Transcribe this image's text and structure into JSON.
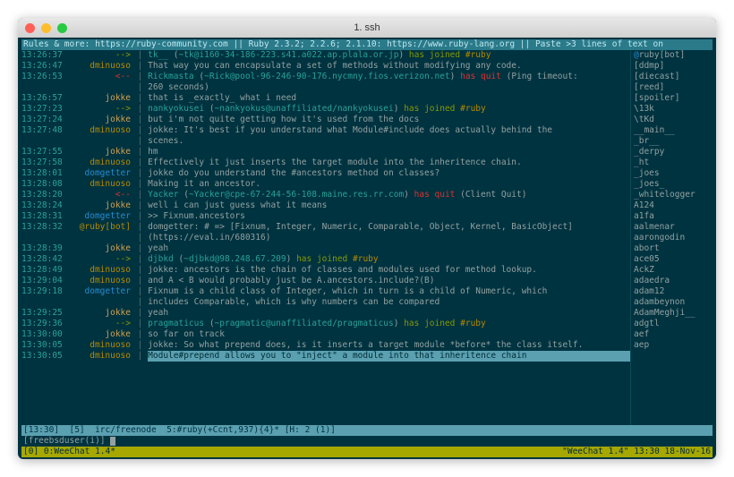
{
  "window": {
    "title": "1. ssh"
  },
  "topbar": "Rules & more: https://ruby-community.com || Ruby 2.3.2; 2.2.6; 2.1.10: https://www.ruby-lang.org || Paste >3 lines of text on",
  "nicklist": [
    {
      "p": "@",
      "n": "ruby[bot]"
    },
    {
      "p": " ",
      "n": "[ddmp]"
    },
    {
      "p": " ",
      "n": "[diecast]"
    },
    {
      "p": " ",
      "n": "[reed]"
    },
    {
      "p": " ",
      "n": "[spoiler]"
    },
    {
      "p": " ",
      "n": "\\13k"
    },
    {
      "p": " ",
      "n": "\\tKd"
    },
    {
      "p": " ",
      "n": "__main__"
    },
    {
      "p": " ",
      "n": "_br__"
    },
    {
      "p": " ",
      "n": "_derpy"
    },
    {
      "p": " ",
      "n": "_ht"
    },
    {
      "p": " ",
      "n": "_joes"
    },
    {
      "p": " ",
      "n": "_joes_"
    },
    {
      "p": " ",
      "n": "_whitelogger"
    },
    {
      "p": " ",
      "n": "A124"
    },
    {
      "p": " ",
      "n": "a1fa"
    },
    {
      "p": " ",
      "n": "aalmenar"
    },
    {
      "p": " ",
      "n": "aarongodin"
    },
    {
      "p": " ",
      "n": "abort"
    },
    {
      "p": " ",
      "n": "ace05"
    },
    {
      "p": " ",
      "n": "AckZ"
    },
    {
      "p": " ",
      "n": "adaedra"
    },
    {
      "p": " ",
      "n": "adam12"
    },
    {
      "p": " ",
      "n": "adambeynon"
    },
    {
      "p": " ",
      "n": "AdamMeghji__"
    },
    {
      "p": " ",
      "n": "adgtl"
    },
    {
      "p": " ",
      "n": "aef"
    },
    {
      "p": " ",
      "n": "aep"
    }
  ],
  "log": [
    {
      "ts": "13:26:37",
      "nick": "-->",
      "ncolor": "arrow-in",
      "msg": [
        {
          "c": "username",
          "t": "tk__"
        },
        {
          "t": " ("
        },
        {
          "c": "host",
          "t": "~tk@i160-34-186-223.s41.a022.ap.plala.or.jp"
        },
        {
          "t": ") "
        },
        {
          "c": "joined",
          "t": "has joined"
        },
        {
          "t": " "
        },
        {
          "c": "channel",
          "t": "#ruby"
        }
      ]
    },
    {
      "ts": "13:26:47",
      "nick": "dminuoso",
      "ncolor": "dminuoso",
      "msg": [
        {
          "t": "That way you can encapsulate a set of methods without modifying any code."
        }
      ]
    },
    {
      "ts": "13:26:53",
      "nick": "<--",
      "ncolor": "arrow-out",
      "msg": [
        {
          "c": "username",
          "t": "Rickmasta"
        },
        {
          "t": " ("
        },
        {
          "c": "host",
          "t": "~Rick@pool-96-246-90-176.nycmny.fios.verizon.net"
        },
        {
          "t": ") "
        },
        {
          "c": "quit",
          "t": "has quit"
        },
        {
          "t": " (Ping timeout:"
        }
      ]
    },
    {
      "ts": "",
      "nick": "",
      "msg": [
        {
          "t": "260 seconds)"
        }
      ]
    },
    {
      "ts": "13:26:57",
      "nick": "jokke",
      "ncolor": "jokke",
      "msg": [
        {
          "t": "that is _exactly_ what i need"
        }
      ]
    },
    {
      "ts": "13:27:23",
      "nick": "-->",
      "ncolor": "arrow-in",
      "msg": [
        {
          "c": "username",
          "t": "nankyokusei"
        },
        {
          "t": " ("
        },
        {
          "c": "host",
          "t": "~nankyokus@unaffiliated/nankyokusei"
        },
        {
          "t": ") "
        },
        {
          "c": "joined",
          "t": "has joined"
        },
        {
          "t": " "
        },
        {
          "c": "channel",
          "t": "#ruby"
        }
      ]
    },
    {
      "ts": "13:27:24",
      "nick": "jokke",
      "ncolor": "jokke",
      "msg": [
        {
          "t": "but i'm not quite getting how it's used from the docs"
        }
      ]
    },
    {
      "ts": "13:27:48",
      "nick": "dminuoso",
      "ncolor": "dminuoso",
      "msg": [
        {
          "t": "jokke: It's best if you understand what Module#include does actually behind the"
        }
      ]
    },
    {
      "ts": "",
      "nick": "",
      "msg": [
        {
          "t": "scenes."
        }
      ]
    },
    {
      "ts": "13:27:55",
      "nick": "jokke",
      "ncolor": "jokke",
      "msg": [
        {
          "t": "hm"
        }
      ]
    },
    {
      "ts": "13:27:58",
      "nick": "dminuoso",
      "ncolor": "dminuoso",
      "msg": [
        {
          "t": "Effectively it just inserts the target module into the inheritence chain."
        }
      ]
    },
    {
      "ts": "13:28:01",
      "nick": "domgetter",
      "ncolor": "domgetter",
      "msg": [
        {
          "t": "jokke do you understand the #ancestors method on classes?"
        }
      ]
    },
    {
      "ts": "13:28:08",
      "nick": "dminuoso",
      "ncolor": "dminuoso",
      "msg": [
        {
          "t": "Making it an ancestor."
        }
      ]
    },
    {
      "ts": "13:28:20",
      "nick": "<--",
      "ncolor": "arrow-out",
      "msg": [
        {
          "c": "username",
          "t": "Yacker"
        },
        {
          "t": " ("
        },
        {
          "c": "host",
          "t": "~Yacker@cpe-67-244-56-108.maine.res.rr.com"
        },
        {
          "t": ") "
        },
        {
          "c": "quit",
          "t": "has quit"
        },
        {
          "t": " (Client Quit)"
        }
      ]
    },
    {
      "ts": "13:28:24",
      "nick": "jokke",
      "ncolor": "jokke",
      "msg": [
        {
          "t": "well i can just guess what it means"
        }
      ]
    },
    {
      "ts": "13:28:31",
      "nick": "domgetter",
      "ncolor": "domgetter",
      "msg": [
        {
          "t": ">> Fixnum.ancestors"
        }
      ]
    },
    {
      "ts": "13:28:32",
      "nick": "@ruby[bot]",
      "ncolor": "ruby-bot",
      "msg": [
        {
          "t": "domgetter: # => [Fixnum, Integer, Numeric, Comparable, Object, Kernel, BasicObject]"
        }
      ]
    },
    {
      "ts": "",
      "nick": "",
      "msg": [
        {
          "t": "(https://eval.in/680316)"
        }
      ]
    },
    {
      "ts": "13:28:39",
      "nick": "jokke",
      "ncolor": "jokke",
      "msg": [
        {
          "t": "yeah"
        }
      ]
    },
    {
      "ts": "13:28:42",
      "nick": "-->",
      "ncolor": "arrow-in",
      "msg": [
        {
          "c": "username",
          "t": "djbkd"
        },
        {
          "t": " ("
        },
        {
          "c": "host",
          "t": "~djbkd@98.248.67.209"
        },
        {
          "t": ") "
        },
        {
          "c": "joined",
          "t": "has joined"
        },
        {
          "t": " "
        },
        {
          "c": "channel",
          "t": "#ruby"
        }
      ]
    },
    {
      "ts": "13:28:49",
      "nick": "dminuoso",
      "ncolor": "dminuoso",
      "msg": [
        {
          "t": "jokke: ancestors is the chain of classes and modules used for method lookup."
        }
      ]
    },
    {
      "ts": "13:29:04",
      "nick": "dminuoso",
      "ncolor": "dminuoso",
      "msg": [
        {
          "t": "and A < B would probably just be A.ancestors.include?(B)"
        }
      ]
    },
    {
      "ts": "13:29:18",
      "nick": "domgetter",
      "ncolor": "domgetter",
      "msg": [
        {
          "t": "Fixnum is a child class of Integer, which in turn is a child of Numeric, which"
        }
      ]
    },
    {
      "ts": "",
      "nick": "",
      "msg": [
        {
          "t": "includes Comparable, which is why numbers can be compared"
        }
      ]
    },
    {
      "ts": "13:29:25",
      "nick": "jokke",
      "ncolor": "jokke",
      "msg": [
        {
          "t": "yeah"
        }
      ]
    },
    {
      "ts": "13:29:36",
      "nick": "-->",
      "ncolor": "arrow-in",
      "msg": [
        {
          "c": "username",
          "t": "pragmaticus"
        },
        {
          "t": " ("
        },
        {
          "c": "host",
          "t": "~pragmatic@unaffiliated/pragmaticus"
        },
        {
          "t": ") "
        },
        {
          "c": "joined",
          "t": "has joined"
        },
        {
          "t": " "
        },
        {
          "c": "channel",
          "t": "#ruby"
        }
      ]
    },
    {
      "ts": "13:30:00",
      "nick": "jokke",
      "ncolor": "jokke",
      "msg": [
        {
          "t": "so far on track"
        }
      ]
    },
    {
      "ts": "13:30:05",
      "nick": "dminuoso",
      "ncolor": "dminuoso",
      "msg": [
        {
          "t": "jokke: So what prepend does, is it inserts a target module *before* the class itself."
        }
      ]
    },
    {
      "ts": "13:30:05",
      "nick": "dminuoso",
      "ncolor": "dminuoso",
      "msg": [
        {
          "c": "hl-self",
          "t": "Module#prepend allows you to \"inject\" a module into that inheritence chain        "
        },
        {
          "c": "more",
          "t": "++"
        }
      ]
    }
  ],
  "statusbar": "[13:30]  [5]  irc/freenode  5:#ruby(+Ccnt,937){4}* [H: 2 (1)]",
  "inputprompt": "[freebsduser(i)]",
  "bottombar_left": "[0] 0:WeeChat 1.4*",
  "bottombar_right": "\"WeeChat 1.4\" 13:30 18-Nov-16"
}
